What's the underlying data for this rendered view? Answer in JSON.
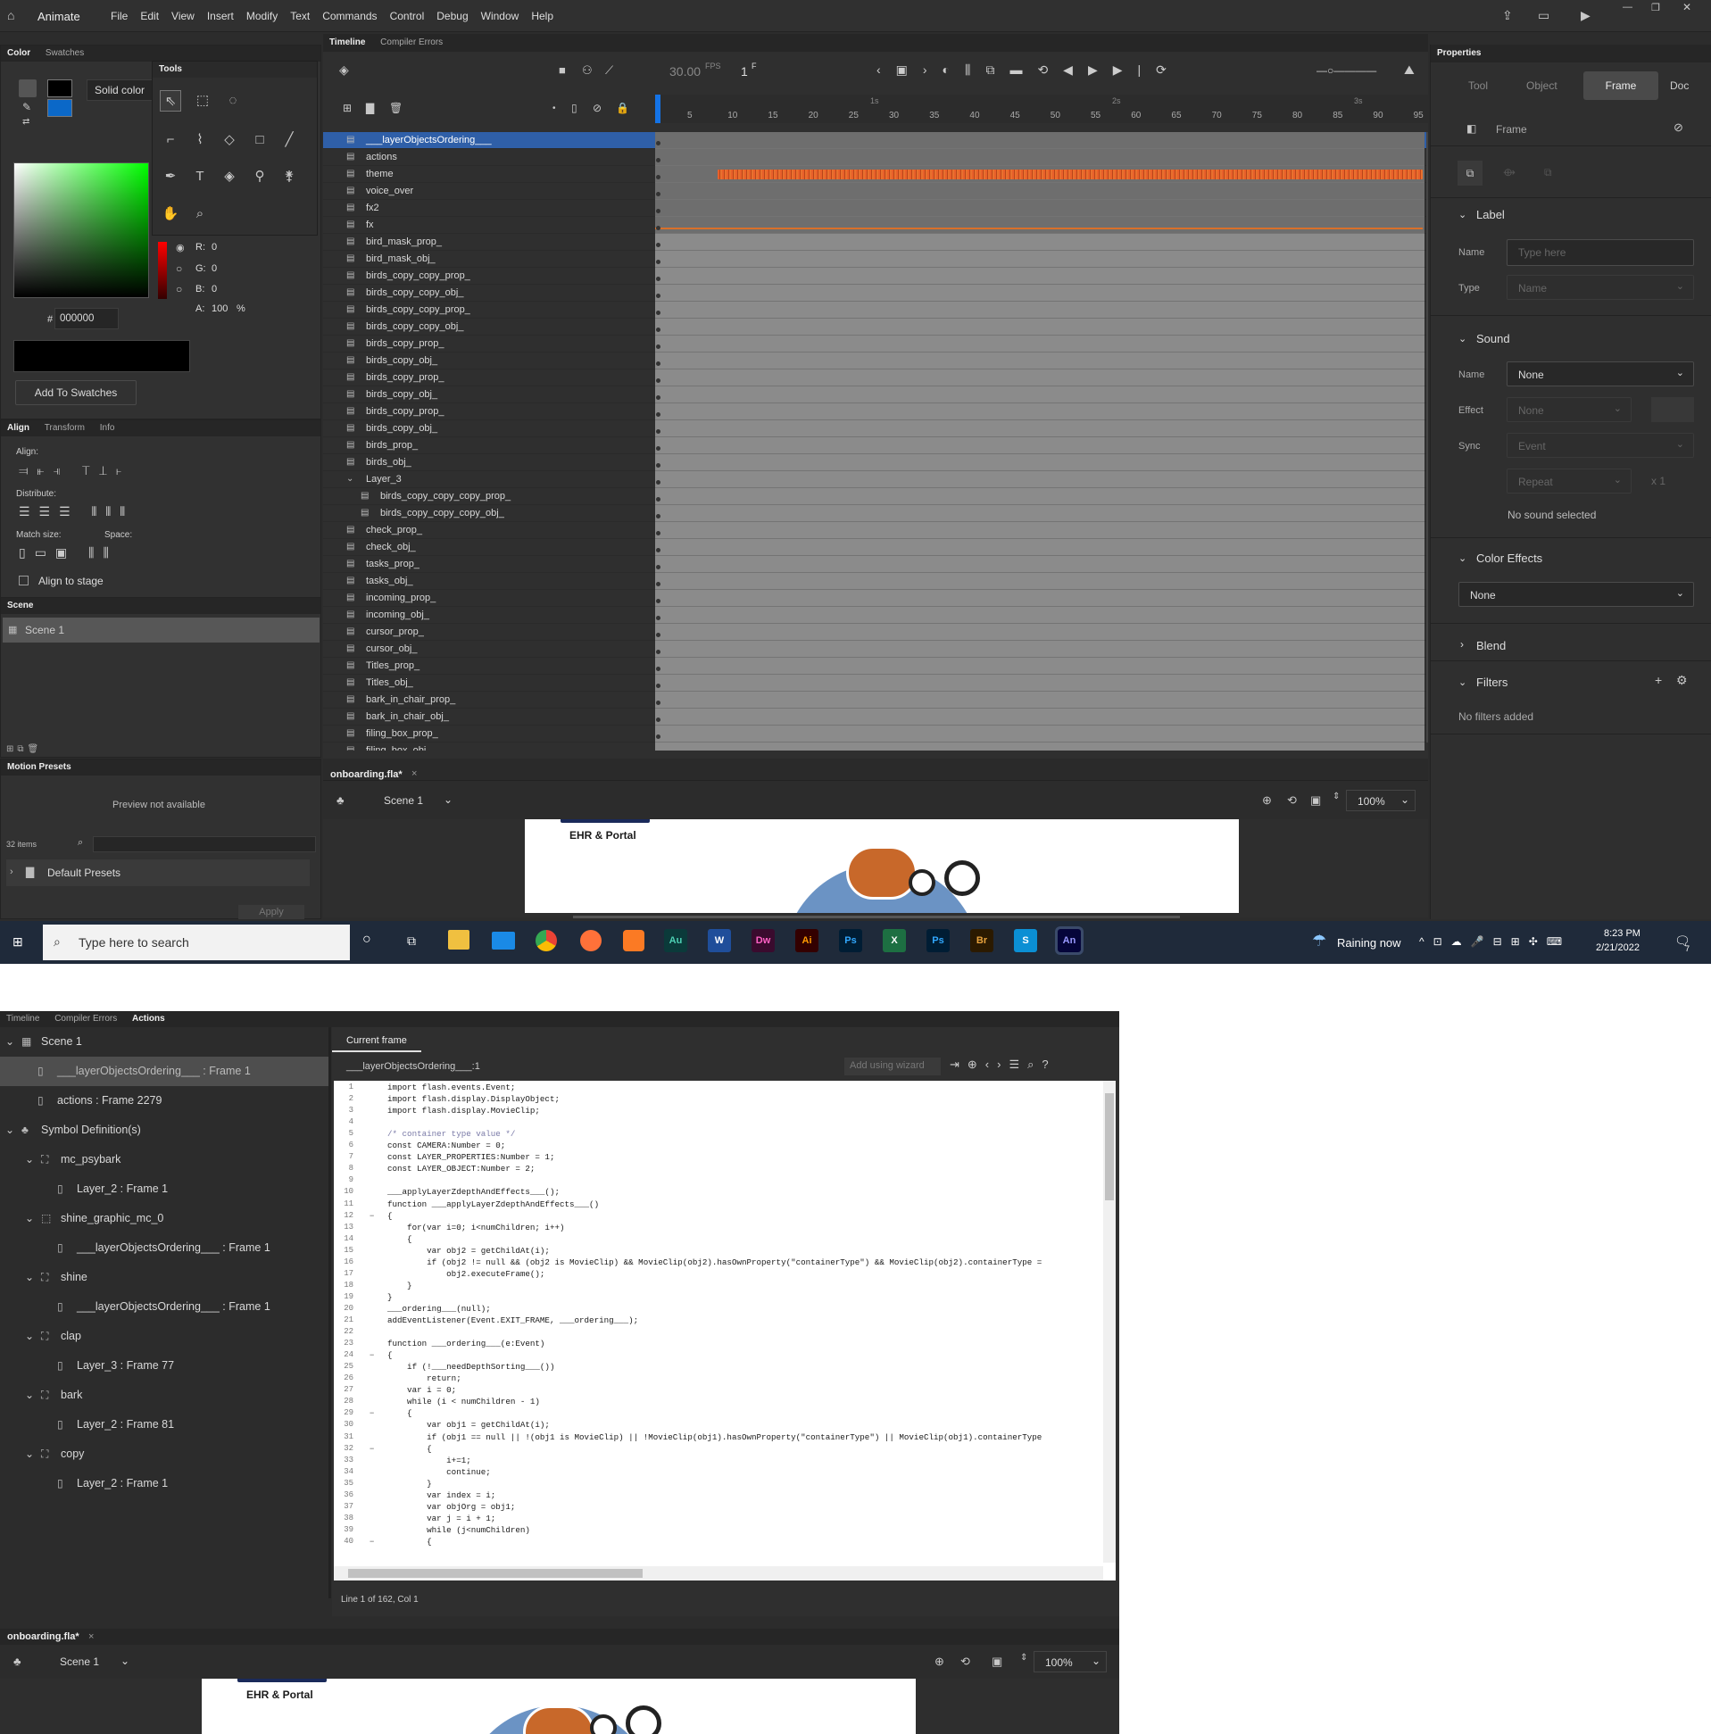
{
  "app": {
    "name": "Animate",
    "menu": [
      "File",
      "Edit",
      "View",
      "Insert",
      "Modify",
      "Text",
      "Commands",
      "Control",
      "Debug",
      "Window",
      "Help"
    ]
  },
  "color_panel": {
    "tabs": [
      "Color",
      "Swatches"
    ],
    "fill_type": "Solid color",
    "r_label": "R:",
    "r": "0",
    "g_label": "G:",
    "g": "0",
    "b_label": "B:",
    "b": "0",
    "a_label": "A:",
    "a": "100",
    "percent": "%",
    "hash": "#",
    "hex": "000000",
    "add_swatches": "Add To Swatches"
  },
  "tools": {
    "title": "Tools"
  },
  "align_panel": {
    "tabs": [
      "Align",
      "Transform",
      "Info"
    ],
    "align_label": "Align:",
    "distribute_label": "Distribute:",
    "match_size_label": "Match size:",
    "space_label": "Space:",
    "align_to_stage": "Align to stage"
  },
  "scene_panel": {
    "title": "Scene",
    "scene_name": "Scene 1"
  },
  "motion_presets": {
    "title": "Motion Presets",
    "preview": "Preview not available",
    "count": "32 items",
    "folder": "Default Presets",
    "apply": "Apply"
  },
  "timeline": {
    "tabs": [
      "Timeline",
      "Compiler Errors"
    ],
    "fps": "30.00",
    "fps_unit": "FPS",
    "frame": "1",
    "frame_unit": "F",
    "ruler_numbers": [
      "5",
      "10",
      "15",
      "20",
      "25",
      "30",
      "35",
      "40",
      "45",
      "50",
      "55",
      "60",
      "65",
      "70",
      "75",
      "80",
      "85",
      "90",
      "95"
    ],
    "ruler_seconds": [
      "1s",
      "2s",
      "3s"
    ],
    "layers": [
      {
        "name": "___layerObjectsOrdering___",
        "color": "#e8202a",
        "selected": true
      },
      {
        "name": "actions",
        "color": "#a33ad6"
      },
      {
        "name": "theme",
        "color": "#1aa58f",
        "audio": true
      },
      {
        "name": "voice_over",
        "color": "#e03ad6"
      },
      {
        "name": "fx2",
        "color": "#e03ad6"
      },
      {
        "name": "fx",
        "color": "#e03ad6",
        "line": true
      },
      {
        "name": "bird_mask_prop_",
        "color": "#e8202a",
        "hidden": true
      },
      {
        "name": "bird_mask_obj_",
        "color": "#e8202a",
        "hidden": true
      },
      {
        "name": "birds_copy_copy_prop_",
        "color": "#e8202a",
        "hidden": true
      },
      {
        "name": "birds_copy_copy_obj_",
        "color": "#e8202a",
        "hidden": true
      },
      {
        "name": "birds_copy_copy_prop_",
        "color": "#e8202a",
        "hidden": true
      },
      {
        "name": "birds_copy_copy_obj_",
        "color": "#e8202a",
        "hidden": true
      },
      {
        "name": "birds_copy_prop_",
        "color": "#e8202a",
        "hidden": true
      },
      {
        "name": "birds_copy_obj_",
        "color": "#e8202a",
        "hidden": true
      },
      {
        "name": "birds_copy_prop_",
        "color": "#e8202a",
        "hidden": true
      },
      {
        "name": "birds_copy_obj_",
        "color": "#e8202a",
        "hidden": true
      },
      {
        "name": "birds_copy_prop_",
        "color": "#e8202a",
        "hidden": true
      },
      {
        "name": "birds_copy_obj_",
        "color": "#e8202a",
        "hidden": true
      },
      {
        "name": "birds_prop_",
        "color": "#e8202a",
        "hidden": true
      },
      {
        "name": "birds_obj_",
        "color": "#e8202a",
        "hidden": true
      },
      {
        "name": "Layer_3",
        "color": "#e03ad6",
        "folder": true
      },
      {
        "name": "birds_copy_copy_copy_prop_",
        "color": "#e8202a",
        "indent": true
      },
      {
        "name": "birds_copy_copy_copy_obj_",
        "color": "#e8202a",
        "indent": true
      },
      {
        "name": "check_prop_",
        "color": "#e8202a"
      },
      {
        "name": "check_obj_",
        "color": "#e8202a"
      },
      {
        "name": "tasks_prop_",
        "color": "#e8202a"
      },
      {
        "name": "tasks_obj_",
        "color": "#e8202a"
      },
      {
        "name": "incoming_prop_",
        "color": "#e8202a"
      },
      {
        "name": "incoming_obj_",
        "color": "#e8202a"
      },
      {
        "name": "cursor_prop_",
        "color": "#e8202a"
      },
      {
        "name": "cursor_obj_",
        "color": "#e8202a"
      },
      {
        "name": "Titles_prop_",
        "color": "#e8202a"
      },
      {
        "name": "Titles_obj_",
        "color": "#e8202a"
      },
      {
        "name": "bark_in_chair_prop_",
        "color": "#e8202a"
      },
      {
        "name": "bark_in_chair_obj_",
        "color": "#e8202a"
      },
      {
        "name": "filing_box_prop_",
        "color": "#e8202a"
      },
      {
        "name": "filing_box_obj_",
        "color": "#e8202a"
      }
    ]
  },
  "document": {
    "tab": "onboarding.fla*",
    "close": "×",
    "scene": "Scene 1",
    "zoom": "100%",
    "stage_text": "EHR & Portal"
  },
  "properties": {
    "title": "Properties",
    "tabs": [
      "Tool",
      "Object",
      "Frame",
      "Doc"
    ],
    "active_tab": "Frame",
    "frame_heading": "Frame",
    "label_section": "Label",
    "name_label": "Name",
    "name_placeholder": "Type here",
    "type_label": "Type",
    "type_value": "Name",
    "sound_section": "Sound",
    "sound_name_label": "Name",
    "sound_name_value": "None",
    "effect_label": "Effect",
    "effect_value": "None",
    "sync_label": "Sync",
    "sync_value": "Event",
    "repeat_value": "Repeat",
    "repeat_count": "x 1",
    "no_sound": "No sound selected",
    "color_effects_section": "Color Effects",
    "color_effects_value": "None",
    "blend_section": "Blend",
    "filters_section": "Filters",
    "no_filters": "No filters added"
  },
  "taskbar": {
    "search_placeholder": "Type here to search",
    "weather": "Raining now",
    "time": "8:23 PM",
    "date": "2/21/2022",
    "apps": [
      {
        "name": "Au",
        "color": "#0b3a3a",
        "fg": "#4ed0b4"
      },
      {
        "name": "W",
        "color": "#1f4e9a",
        "fg": "#fff"
      },
      {
        "name": "Dw",
        "color": "#3a0b2e",
        "fg": "#ff61c6"
      },
      {
        "name": "Ai",
        "color": "#330000",
        "fg": "#ff9a00"
      },
      {
        "name": "Ps",
        "color": "#001d34",
        "fg": "#31a8ff"
      },
      {
        "name": "X",
        "color": "#1d6f42",
        "fg": "#fff"
      },
      {
        "name": "Ps",
        "color": "#001d34",
        "fg": "#31a8ff"
      },
      {
        "name": "Br",
        "color": "#2b1a00",
        "fg": "#e8a33d"
      },
      {
        "name": "S",
        "color": "#0b8fd4",
        "fg": "#fff"
      },
      {
        "name": "An",
        "color": "#05053a",
        "fg": "#9999ff"
      }
    ],
    "notif_count": "7"
  },
  "actions_panel": {
    "tabs": [
      "Timeline",
      "Compiler Errors",
      "Actions"
    ],
    "current_frame": "Current frame",
    "script_path": "___layerObjectsOrdering___:1",
    "wizard": "Add using wizard",
    "status": "Line 1 of 162, Col 1",
    "tree": [
      {
        "label": "Scene 1",
        "level": 0,
        "kind": "scene",
        "expand": true
      },
      {
        "label": "___layerObjectsOrdering___ : Frame 1",
        "level": 1,
        "kind": "frame",
        "selected": true
      },
      {
        "label": "actions : Frame 2279",
        "level": 1,
        "kind": "frame"
      },
      {
        "label": "Symbol Definition(s)",
        "level": 0,
        "kind": "symbols",
        "expand": true
      },
      {
        "label": "mc_psybark",
        "level": 1,
        "kind": "clip",
        "expand": true
      },
      {
        "label": "Layer_2 : Frame 1",
        "level": 2,
        "kind": "frame"
      },
      {
        "label": "shine_graphic_mc_0",
        "level": 1,
        "kind": "graphic",
        "expand": true
      },
      {
        "label": "___layerObjectsOrdering___ : Frame 1",
        "level": 2,
        "kind": "frame"
      },
      {
        "label": "shine",
        "level": 1,
        "kind": "clip",
        "expand": true
      },
      {
        "label": "___layerObjectsOrdering___ : Frame 1",
        "level": 2,
        "kind": "frame"
      },
      {
        "label": "clap",
        "level": 1,
        "kind": "clip",
        "expand": true
      },
      {
        "label": "Layer_3 : Frame 77",
        "level": 2,
        "kind": "frame"
      },
      {
        "label": "bark",
        "level": 1,
        "kind": "clip",
        "expand": true
      },
      {
        "label": "Layer_2 : Frame 81",
        "level": 2,
        "kind": "frame"
      },
      {
        "label": "copy",
        "level": 1,
        "kind": "clip",
        "expand": true
      },
      {
        "label": "Layer_2 : Frame 1",
        "level": 2,
        "kind": "frame"
      }
    ],
    "code": [
      "import flash.events.Event;",
      "import flash.display.DisplayObject;",
      "import flash.display.MovieClip;",
      "",
      "/* container type value */",
      "const CAMERA:Number = 0;",
      "const LAYER_PROPERTIES:Number = 1;",
      "const LAYER_OBJECT:Number = 2;",
      "",
      "___applyLayerZdepthAndEffects___();",
      "function ___applyLayerZdepthAndEffects___()",
      "{",
      "    for(var i=0; i<numChildren; i++)",
      "    {",
      "        var obj2 = getChildAt(i);",
      "        if (obj2 != null && (obj2 is MovieClip) && MovieClip(obj2).hasOwnProperty(\"containerType\") && MovieClip(obj2).containerType =",
      "            obj2.executeFrame();",
      "    }",
      "}",
      "___ordering___(null);",
      "addEventListener(Event.EXIT_FRAME, ___ordering___);",
      "",
      "function ___ordering___(e:Event)",
      "{",
      "    if (!___needDepthSorting___())",
      "        return;",
      "    var i = 0;",
      "    while (i < numChildren - 1)",
      "    {",
      "        var obj1 = getChildAt(i);",
      "        if (obj1 == null || !(obj1 is MovieClip) || !MovieClip(obj1).hasOwnProperty(\"containerType\") || MovieClip(obj1).containerType",
      "        {",
      "            i+=1;",
      "            continue;",
      "        }",
      "        var index = i;",
      "        var objOrg = obj1;",
      "        var j = i + 1;",
      "        while (j<numChildren)",
      "        {"
    ],
    "doc_tab": "onboarding.fla*",
    "scene": "Scene 1",
    "zoom": "100%",
    "stage_text": "EHR & Portal"
  }
}
